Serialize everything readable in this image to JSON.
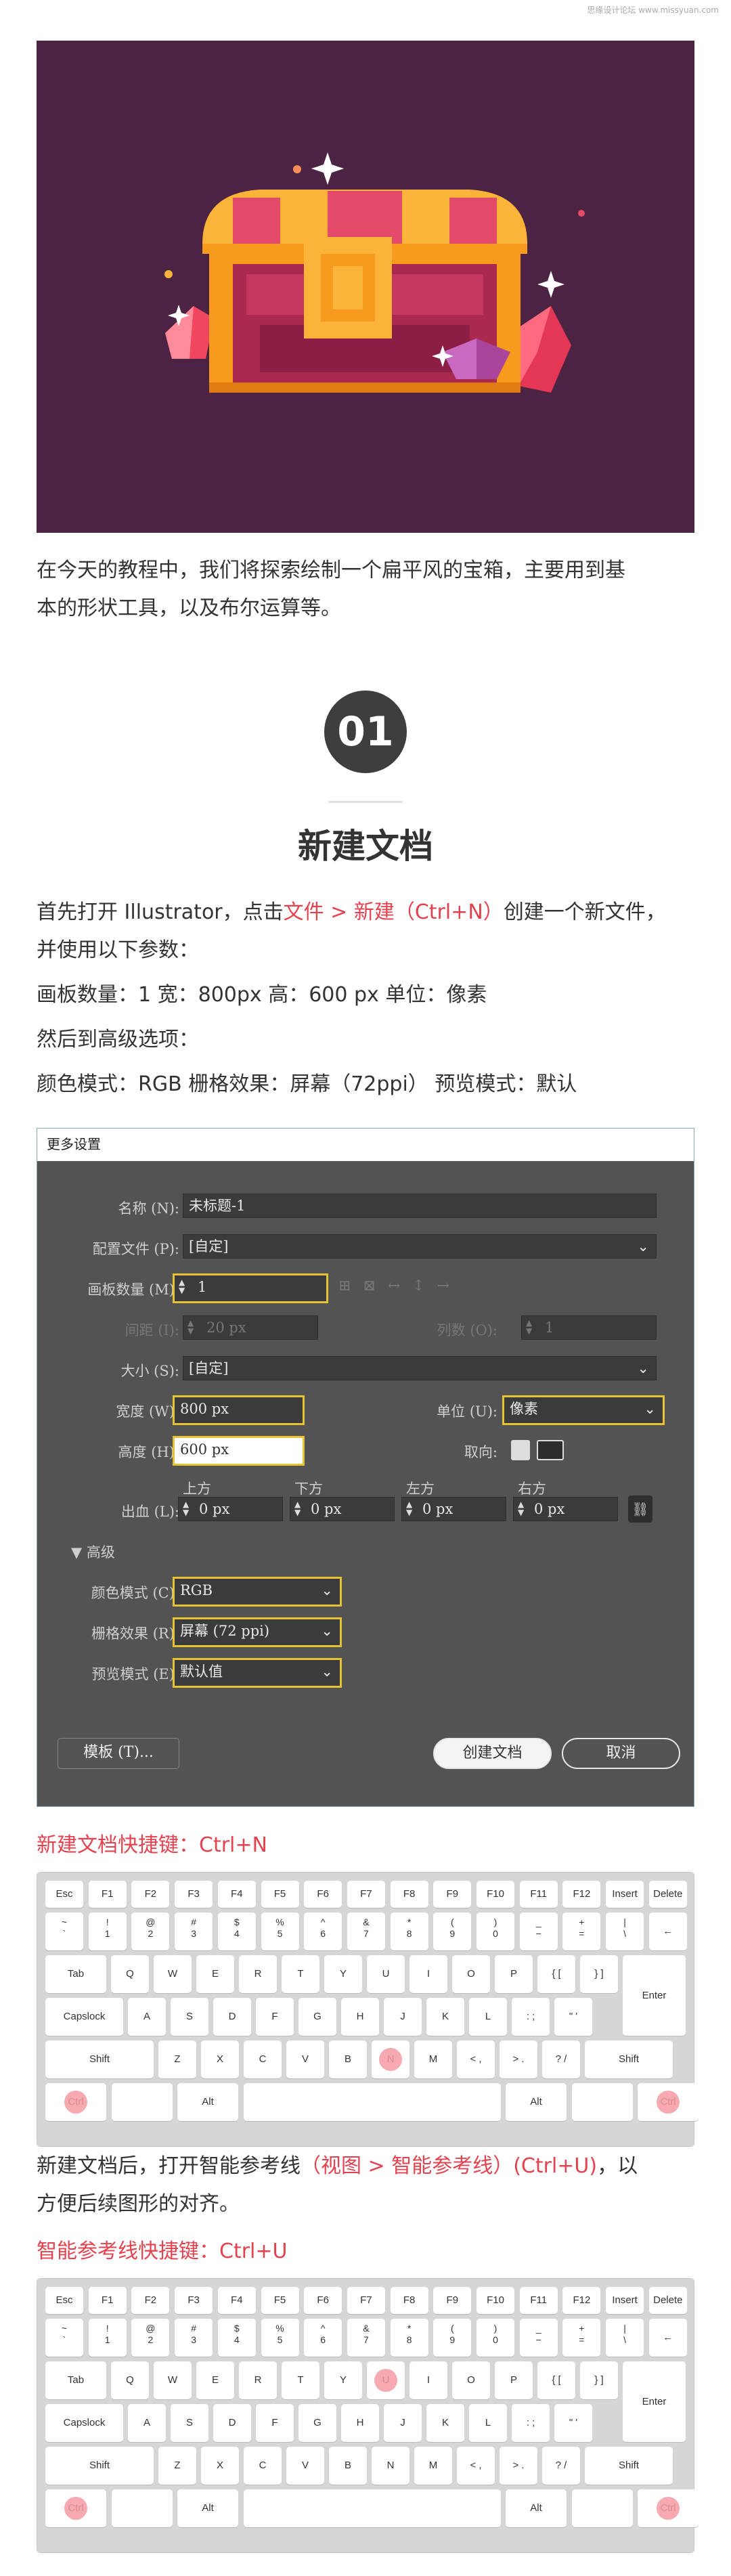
{
  "watermark": "思缘设计论坛 www.missyuan.com",
  "intro": {
    "line1": "在今天的教程中，我们将探索绘制一个扁平风的宝箱，主要用到基",
    "line2": "本的形状工具，以及布尔运算等。"
  },
  "step": {
    "number": "01",
    "title": "新建文档"
  },
  "instructions": {
    "p1_a": "首先打开 Illustrator，点击",
    "p1_menu": "文件 > 新建（Ctrl+N）",
    "p1_b": "创建一个新文件，",
    "p1_line2": "并使用以下参数：",
    "p2": "画板数量：1    宽：800px    高：600 px    单位：像素",
    "p3": "然后到高级选项：",
    "p4": "颜色模式：RGB    栅格效果：屏幕（72ppi）    预览模式：默认"
  },
  "dialog": {
    "title": "更多设置",
    "name_label": "名称 (N):",
    "name_value": "未标题-1",
    "profile_label": "配置文件 (P):",
    "profile_value": "[自定]",
    "artboards_label": "画板数量 (M):",
    "artboards_value": "1",
    "spacing_label": "间距 (I):",
    "spacing_value": "20 px",
    "columns_label": "列数 (O):",
    "columns_value": "1",
    "size_label": "大小 (S):",
    "size_value": "[自定]",
    "width_label": "宽度 (W):",
    "width_value": "800 px",
    "units_label": "单位 (U):",
    "units_value": "像素",
    "height_label": "高度 (H):",
    "height_value": "600 px",
    "orientation_label": "取向:",
    "bleed_label": "出血 (L):",
    "bleed_top": "上方",
    "bleed_bottom": "下方",
    "bleed_left": "左方",
    "bleed_right": "右方",
    "bleed_value": "0 px",
    "advanced_label": "高级",
    "color_mode_label": "颜色模式 (C):",
    "color_mode_value": "RGB",
    "raster_label": "栅格效果 (R):",
    "raster_value": "屏幕 (72 ppi)",
    "preview_label": "预览模式 (E):",
    "preview_value": "默认值",
    "templates_button": "模板 (T)...",
    "create_button": "创建文档",
    "cancel_button": "取消"
  },
  "shortcut1_caption": "新建文档快捷键：Ctrl+N",
  "para_guides": {
    "a": "新建文档后，打开智能参考线",
    "menu": "（视图 > 智能参考线）(Ctrl+U)",
    "b": "，以",
    "line2": "方便后续图形的对齐。"
  },
  "shortcut2_caption": "智能参考线快捷键：Ctrl+U",
  "colors": {
    "accent": "#e5424f",
    "dialog_bg": "#535353",
    "highlight": "#e7c334",
    "hero_bg": "#4d2344"
  },
  "keyboard": {
    "row1": [
      "Esc",
      "F1",
      "F2",
      "F3",
      "F4",
      "F5",
      "F6",
      "F7",
      "F8",
      "F9",
      "F10",
      "F11",
      "F12",
      "Insert",
      "Delete"
    ],
    "row2": [
      [
        "~",
        "`"
      ],
      [
        "!",
        "1"
      ],
      [
        "@",
        "2"
      ],
      [
        "#",
        "3"
      ],
      [
        "$",
        "4"
      ],
      [
        "%",
        "5"
      ],
      [
        "^",
        "6"
      ],
      [
        "&",
        "7"
      ],
      [
        "*",
        "8"
      ],
      [
        "(",
        "9"
      ],
      [
        ")",
        "0"
      ],
      [
        "_",
        "−"
      ],
      [
        "+",
        "="
      ],
      [
        "|",
        "\\"
      ],
      [
        "←",
        ""
      ]
    ],
    "row3": [
      "Tab",
      "Q",
      "W",
      "E",
      "R",
      "T",
      "Y",
      "U",
      "I",
      "O",
      "P",
      "{ [",
      "} ]"
    ],
    "row4": [
      "Capslock",
      "A",
      "S",
      "D",
      "F",
      "G",
      "H",
      "J",
      "K",
      "L",
      ": ;",
      "\" '",
      "Enter"
    ],
    "row5": [
      "Shift",
      "Z",
      "X",
      "C",
      "V",
      "B",
      "N",
      "M",
      "< ,",
      "> .",
      "? /",
      "Shift"
    ],
    "row6": [
      "Ctrl",
      "",
      "Alt",
      "",
      "Alt",
      "",
      "Ctrl"
    ]
  }
}
